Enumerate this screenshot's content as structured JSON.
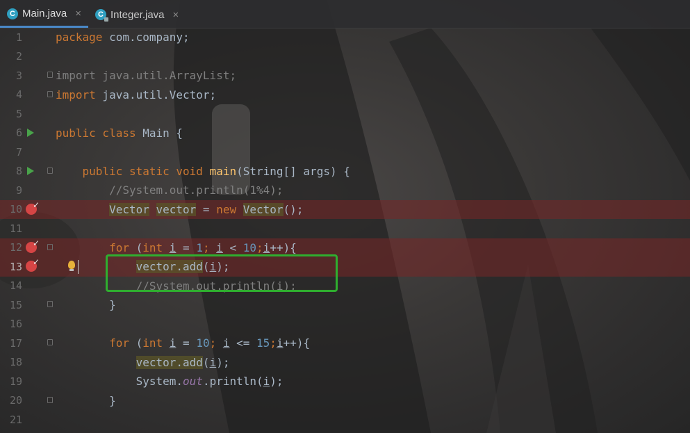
{
  "tabs": [
    {
      "label": "Main.java",
      "active": true,
      "close": "×"
    },
    {
      "label": "Integer.java",
      "active": false,
      "close": "×"
    }
  ],
  "icon_letter": "C",
  "lines": [
    {
      "n": "1"
    },
    {
      "n": "2"
    },
    {
      "n": "3"
    },
    {
      "n": "4"
    },
    {
      "n": "5"
    },
    {
      "n": "6"
    },
    {
      "n": "7"
    },
    {
      "n": "8"
    },
    {
      "n": "9"
    },
    {
      "n": "10"
    },
    {
      "n": "11"
    },
    {
      "n": "12"
    },
    {
      "n": "13"
    },
    {
      "n": "14"
    },
    {
      "n": "15"
    },
    {
      "n": "16"
    },
    {
      "n": "17"
    },
    {
      "n": "18"
    },
    {
      "n": "19"
    },
    {
      "n": "20"
    },
    {
      "n": "21"
    }
  ],
  "code": {
    "l1": {
      "kw": "package",
      "rest": " com.company;"
    },
    "l3": {
      "text": "import java.util.ArrayList;"
    },
    "l4": {
      "kw": "import",
      "rest": " java.util.Vector;"
    },
    "l6": {
      "kw": "public class",
      "rest": " Main {"
    },
    "l8": {
      "kw": "public static void",
      "fn": "main",
      "rest": "(String[] args) {"
    },
    "l9": {
      "text": "//System.out.println(1%4);"
    },
    "l10": {
      "t1": "Vector",
      "t2": "vector",
      "eq": " = ",
      "kw": "new",
      "t3": "Vector",
      "rest": "();"
    },
    "l12": {
      "kw1": "for",
      "p1": " (",
      "kw2": "int",
      "v1": "i",
      "p2": " = ",
      "n1": "1",
      "p3": "; ",
      "v2": "i",
      "p4": " < ",
      "n2": "10",
      "p5": ";",
      "v3": "i",
      "p6": "++){"
    },
    "l13": {
      "call": "vector.add",
      "p1": "(",
      "v": "i",
      "p2": ");"
    },
    "l14": {
      "text": "//System.out.println(i);"
    },
    "l15": {
      "text": "}"
    },
    "l17": {
      "kw1": "for",
      "p1": " (",
      "kw2": "int",
      "v1": "i",
      "p2": " = ",
      "n1": "10",
      "p3": "; ",
      "v2": "i",
      "p4": " <= ",
      "n2": "15",
      "p5": ";",
      "v3": "i",
      "p6": "++){"
    },
    "l18": {
      "call": "vector.add",
      "p1": "(",
      "v": "i",
      "p2": ");"
    },
    "l19": {
      "a": "System.",
      "field": "out",
      "b": ".println(",
      "v": "i",
      "c": ");"
    },
    "l20": {
      "text": "}"
    }
  },
  "colors": {
    "accent": "#4a88c7",
    "breakpoint": "#d64545",
    "highlight_box": "#2fae2f"
  }
}
